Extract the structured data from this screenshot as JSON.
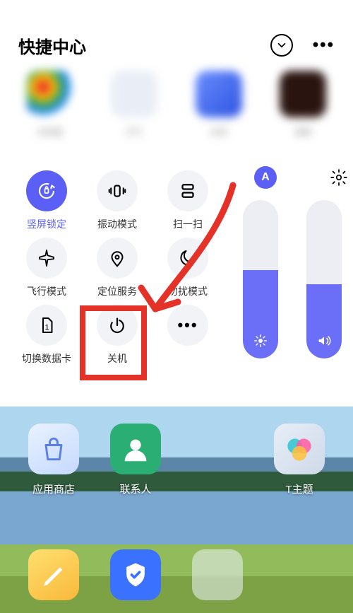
{
  "header": {
    "title": "快捷中心"
  },
  "recent": [
    {
      "label": "浏览器"
    },
    {
      "label": "天气"
    },
    {
      "label": "应用"
    },
    {
      "label": "相册"
    }
  ],
  "toggles": {
    "row1": [
      {
        "id": "rotation-lock",
        "label": "竖屏锁定",
        "icon": "rotation-lock-icon",
        "active": true
      },
      {
        "id": "vibrate",
        "label": "振动模式",
        "icon": "vibrate-icon",
        "active": false
      },
      {
        "id": "scan",
        "label": "扫一扫",
        "icon": "scan-icon",
        "active": false
      }
    ],
    "row2": [
      {
        "id": "airplane",
        "label": "飞行模式",
        "icon": "airplane-icon",
        "active": false
      },
      {
        "id": "location",
        "label": "定位服务",
        "icon": "location-icon",
        "active": false
      },
      {
        "id": "dnd",
        "label": "勿扰模式",
        "icon": "dnd-icon",
        "active": false
      }
    ],
    "row3": [
      {
        "id": "sim-switch",
        "label": "切换数据卡",
        "icon": "sim-icon",
        "active": false
      },
      {
        "id": "power-off",
        "label": "关机",
        "icon": "power-icon",
        "active": false
      },
      {
        "id": "more",
        "label": "",
        "icon": "more-icon",
        "active": false
      }
    ]
  },
  "sliders": {
    "auto_badge_text": "A",
    "brightness_pct": 56,
    "volume_pct": 47
  },
  "annotation": {
    "highlight_target": "power-off",
    "colors": {
      "box": "#e53228",
      "arrow": "#e53228",
      "accent": "#5b5ff5"
    }
  },
  "homescreen": {
    "row1": [
      {
        "label": "应用商店"
      },
      {
        "label": "联系人"
      },
      {
        "label": ""
      },
      {
        "label": "T主题"
      }
    ]
  }
}
